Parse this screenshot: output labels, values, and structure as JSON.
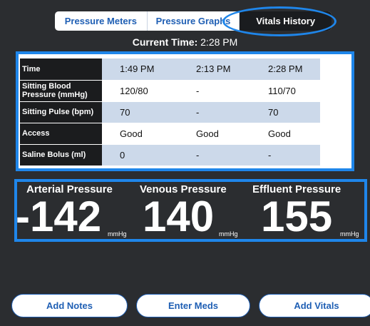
{
  "tabs": [
    {
      "label": "Pressure Meters",
      "active": false
    },
    {
      "label": "Pressure Graphs",
      "active": false
    },
    {
      "label": "Vitals History",
      "active": true
    }
  ],
  "current_time": {
    "label": "Current Time:",
    "value": "2:28 PM"
  },
  "vitals_table": {
    "rows": [
      {
        "label": "Time",
        "values": [
          "1:49 PM",
          "2:13 PM",
          "2:28 PM"
        ]
      },
      {
        "label": "Sitting Blood Pressure (mmHg)",
        "values": [
          "120/80",
          "-",
          "110/70"
        ]
      },
      {
        "label": "Sitting Pulse (bpm)",
        "values": [
          "70",
          "-",
          "70"
        ]
      },
      {
        "label": "Access",
        "values": [
          "Good",
          "Good",
          "Good"
        ]
      },
      {
        "label": "Saline Bolus (ml)",
        "values": [
          "0",
          "-",
          "-"
        ]
      }
    ]
  },
  "pressures": {
    "arterial": {
      "label": "Arterial Pressure",
      "value": "-142",
      "unit": "mmHg"
    },
    "venous": {
      "label": "Venous Pressure",
      "value": "140",
      "unit": "mmHg"
    },
    "effluent": {
      "label": "Effluent Pressure",
      "value": "155",
      "unit": "mmHg"
    }
  },
  "buttons": {
    "add_notes": "Add Notes",
    "enter_meds": "Enter Meds",
    "add_vitals": "Add Vitals"
  },
  "colors": {
    "background": "#2b2d30",
    "accent_blue": "#1f86ea",
    "button_text": "#1f5fb4",
    "table_shade": "#ccd9ea"
  }
}
